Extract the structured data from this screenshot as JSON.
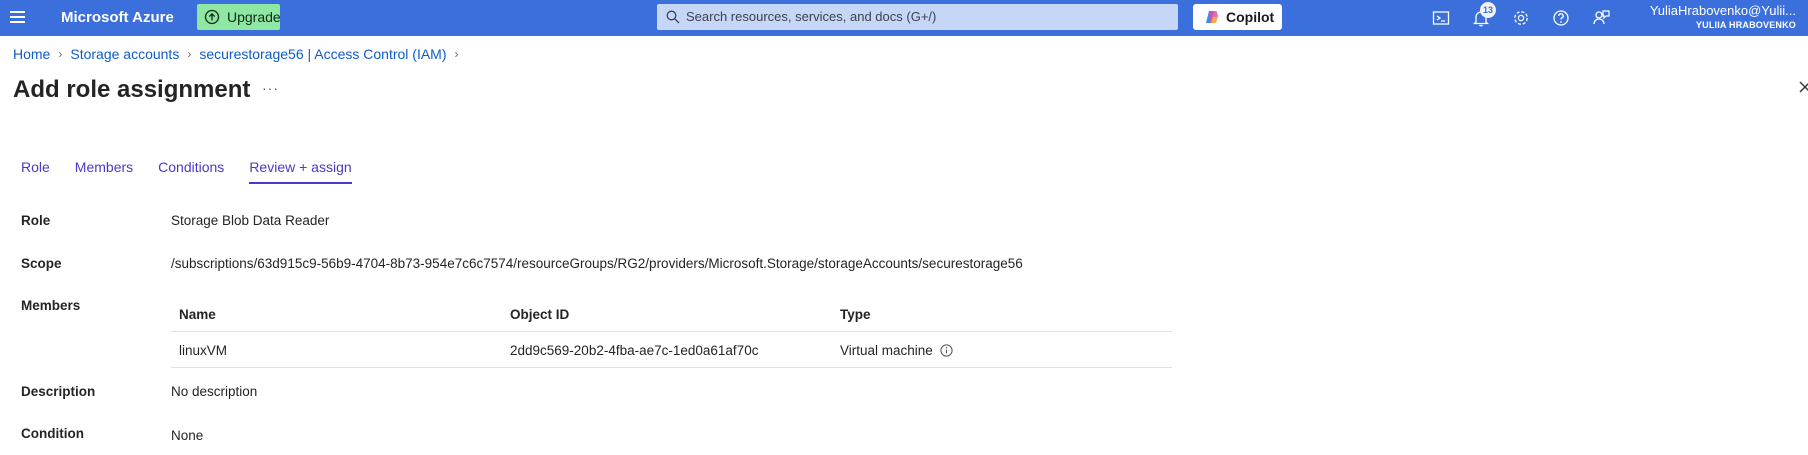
{
  "topbar": {
    "brand": "Microsoft Azure",
    "upgrade_label": "Upgrade",
    "search_placeholder": "Search resources, services, and docs (G+/)",
    "copilot_label": "Copilot",
    "notification_count": "13",
    "user_name": "YuliaHrabovenko@Yulii...",
    "user_org": "YULIIA HRABOVENKO",
    "icons": [
      "menu-icon",
      "cloud-shell-icon",
      "bell-icon",
      "gear-icon",
      "help-icon",
      "feedback-icon"
    ],
    "colors": {
      "bar": "#3b6fdc",
      "upgrade": "#8ee7a2",
      "search": "#c5d6f7"
    }
  },
  "breadcrumb": [
    "Home",
    "Storage accounts",
    "securestorage56 | Access Control (IAM)"
  ],
  "page": {
    "title": "Add role assignment",
    "more": "···"
  },
  "tabs": [
    {
      "label": "Role"
    },
    {
      "label": "Members"
    },
    {
      "label": "Conditions"
    },
    {
      "label": "Review + assign",
      "active": true
    }
  ],
  "details": {
    "role_label": "Role",
    "role_value": "Storage Blob Data Reader",
    "scope_label": "Scope",
    "scope_value": "/subscriptions/63d915c9-56b9-4704-8b73-954e7c6c7574/resourceGroups/RG2/providers/Microsoft.Storage/storageAccounts/securestorage56",
    "members_label": "Members",
    "members_table": {
      "headers": [
        "Name",
        "Object ID",
        "Type"
      ],
      "rows": [
        {
          "name": "linuxVM",
          "object_id": "2dd9c569-20b2-4fba-ae7c-1ed0a61af70c",
          "type": "Virtual machine"
        }
      ]
    },
    "description_label": "Description",
    "description_value": "No description",
    "condition_label": "Condition",
    "condition_value": "None"
  }
}
